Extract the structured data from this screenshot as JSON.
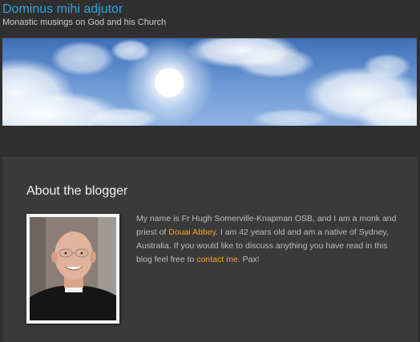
{
  "header": {
    "blog_title": "Dominus mihi adjutor",
    "tagline": "Monastic musings on God and his Church"
  },
  "about": {
    "heading": "About the blogger",
    "bio_part1": "My name is Fr Hugh Somerville-Knapman OSB, and I am a monk and priest of ",
    "abbey_link": "Douai Abbey",
    "bio_part2": ". I am 42 years old and am a native of Sydney, Australia. If you would like to discuss anything you have read in this blog feel free to ",
    "contact_link": "contact me",
    "bio_part3": ". Pax!"
  },
  "colors": {
    "title": "#2fa5d8",
    "link": "#ffa31a",
    "background": "#2f2f2f",
    "panel": "#3a3a3a"
  }
}
